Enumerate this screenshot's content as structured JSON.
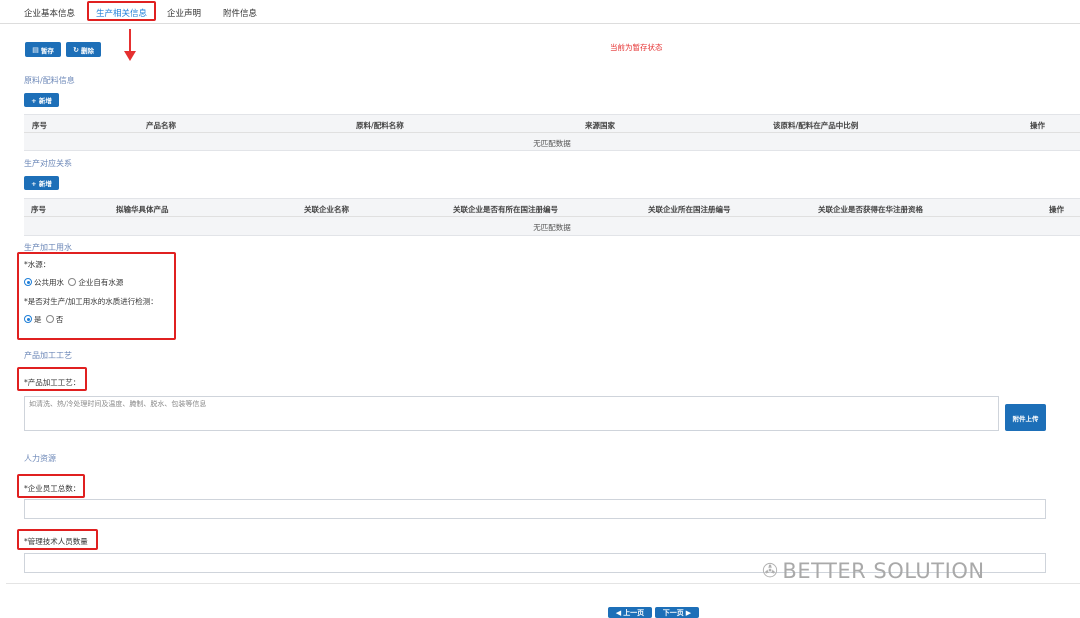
{
  "tabs": [
    {
      "label": "企业基本信息"
    },
    {
      "label": "生产相关信息",
      "active": true
    },
    {
      "label": "企业声明"
    },
    {
      "label": "附件信息"
    }
  ],
  "toolbar": {
    "save_label": "暂存",
    "delete_label": "删除",
    "save_icon": "save-icon",
    "delete_icon": "refresh-icon"
  },
  "status_text": "当前为暂存状态",
  "raw_materials": {
    "title": "原料/配料信息",
    "add_label": "+ 新增",
    "columns": [
      "序号",
      "产品名称",
      "原料/配料名称",
      "来源国家",
      "该原料/配料在产品中比例",
      "操作"
    ],
    "empty_text": "无匹配数据"
  },
  "production_relation": {
    "title": "生产对应关系",
    "add_label": "+ 新增",
    "columns": [
      "序号",
      "拟输华具体产品",
      "关联企业名称",
      "关联企业是否有所在国注册编号",
      "关联企业所在国注册编号",
      "关联企业是否获得在华注册资格",
      "操作"
    ],
    "empty_text": "无匹配数据"
  },
  "water": {
    "title": "生产加工用水",
    "source_label": "*水源：",
    "source_options": [
      {
        "label": "公共用水",
        "checked": true
      },
      {
        "label": "企业自有水源",
        "checked": false
      }
    ],
    "test_label": "*是否对生产/加工用水的水质进行检测：",
    "test_options": [
      {
        "label": "是",
        "checked": true
      },
      {
        "label": "否",
        "checked": false
      }
    ]
  },
  "process": {
    "title": "产品加工工艺",
    "field_label": "*产品加工工艺：",
    "placeholder": "如清洗、热/冷处理时间及温度、腌制、脱水、包装等信息",
    "upload_label": "附件上传"
  },
  "hr": {
    "title": "人力资源",
    "employees_label": "*企业员工总数：",
    "tech_staff_label": "*管理技术人员数量"
  },
  "pager": {
    "prev_label": "上一页",
    "next_label": "下一页"
  },
  "watermark": {
    "text": "BETTER SOLUTION",
    "icon": "wechat-icon"
  },
  "colors": {
    "accent": "#1d6fb8",
    "alert": "#e02020",
    "section_title": "#6d88b8"
  }
}
